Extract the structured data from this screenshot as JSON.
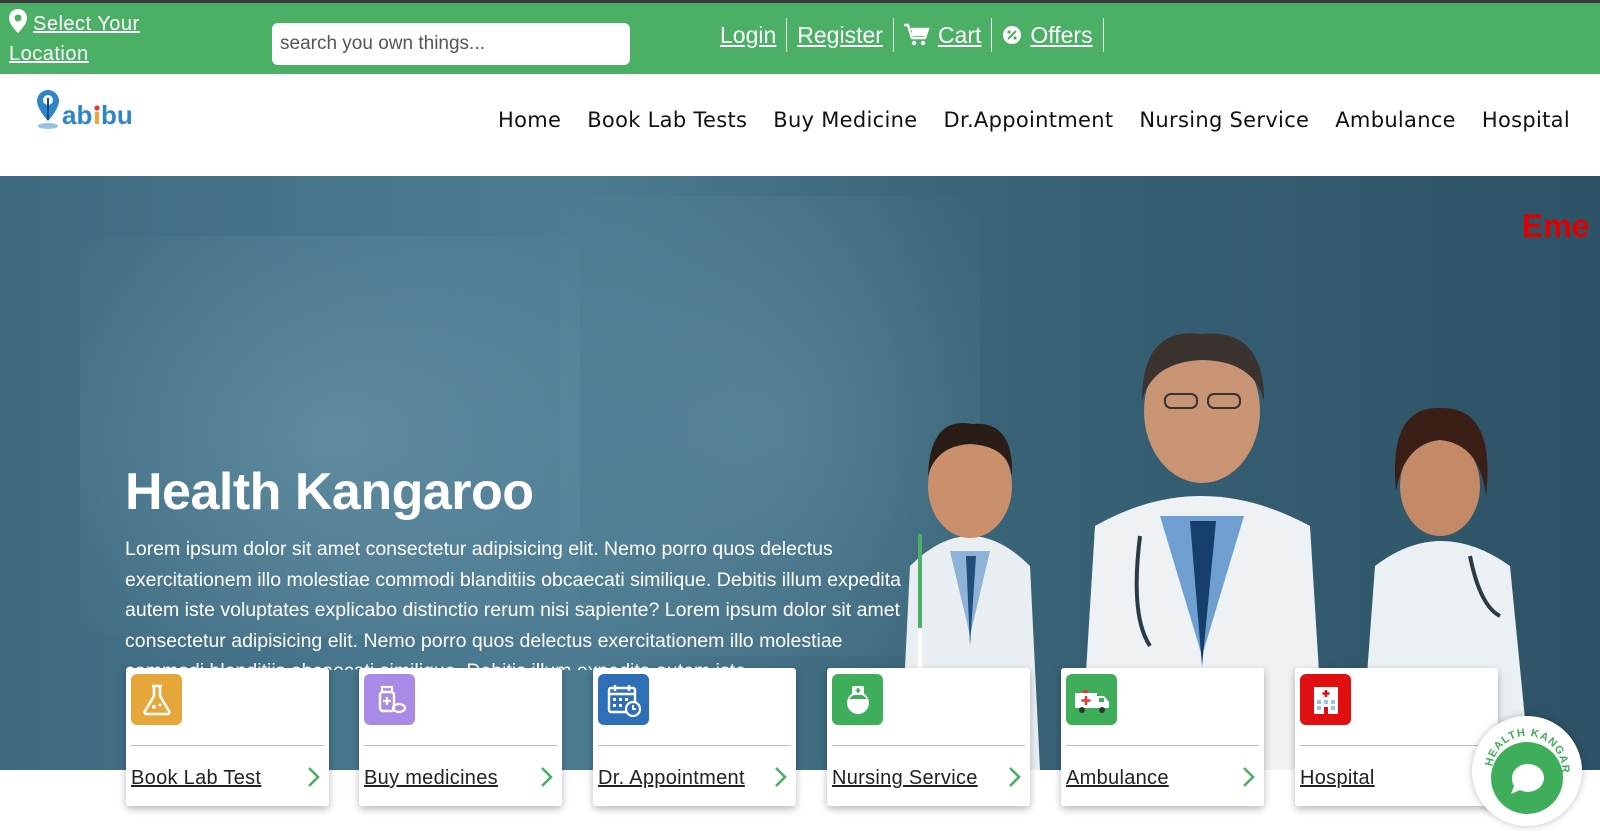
{
  "topbar": {
    "location_label": "Select Your Location",
    "search_placeholder": "search you own things...",
    "links": {
      "login": "Login",
      "register": "Register",
      "cart": "Cart",
      "offers": "Offers"
    }
  },
  "nav": {
    "logo_text": "Labibu",
    "menu": [
      "Home",
      "Book Lab Tests",
      "Buy Medicine",
      "Dr.Appointment",
      "Nursing Service",
      "Ambulance",
      "Hospital"
    ]
  },
  "hero": {
    "marquee": "Eme",
    "title": "Health Kangaroo",
    "text": "Lorem ipsum dolor sit amet consectetur adipisicing elit. Nemo porro quos delectus exercitationem illo molestiae commodi blanditiis obcaecati similique. Debitis illum expedita autem iste voluptates explicabo distinctio rerum nisi sapiente? Lorem ipsum dolor sit amet consectetur adipisicing elit. Nemo porro quos delectus exercitationem illo molestiae commodi blanditiis obcaecati similique. Debitis illum expedita autem iste"
  },
  "services": [
    {
      "label": "Book Lab Test",
      "icon": "flask-icon",
      "color": "#e5a63a"
    },
    {
      "label": "Buy medicines",
      "icon": "medicine-icon",
      "color": "#a98ae6"
    },
    {
      "label": "Dr. Appointment",
      "icon": "calendar-icon",
      "color": "#2e6fb8"
    },
    {
      "label": "Nursing Service",
      "icon": "nurse-icon",
      "color": "#3fae5a"
    },
    {
      "label": "Ambulance",
      "icon": "ambulance-icon",
      "color": "#3fae5a"
    },
    {
      "label": "Hospital",
      "icon": "hospital-icon",
      "color": "#e01010"
    }
  ],
  "chat": {
    "badge_text": "HEALTH KANGAROO"
  },
  "colors": {
    "brand_green": "#4caf66",
    "marquee_red": "#e00000"
  }
}
